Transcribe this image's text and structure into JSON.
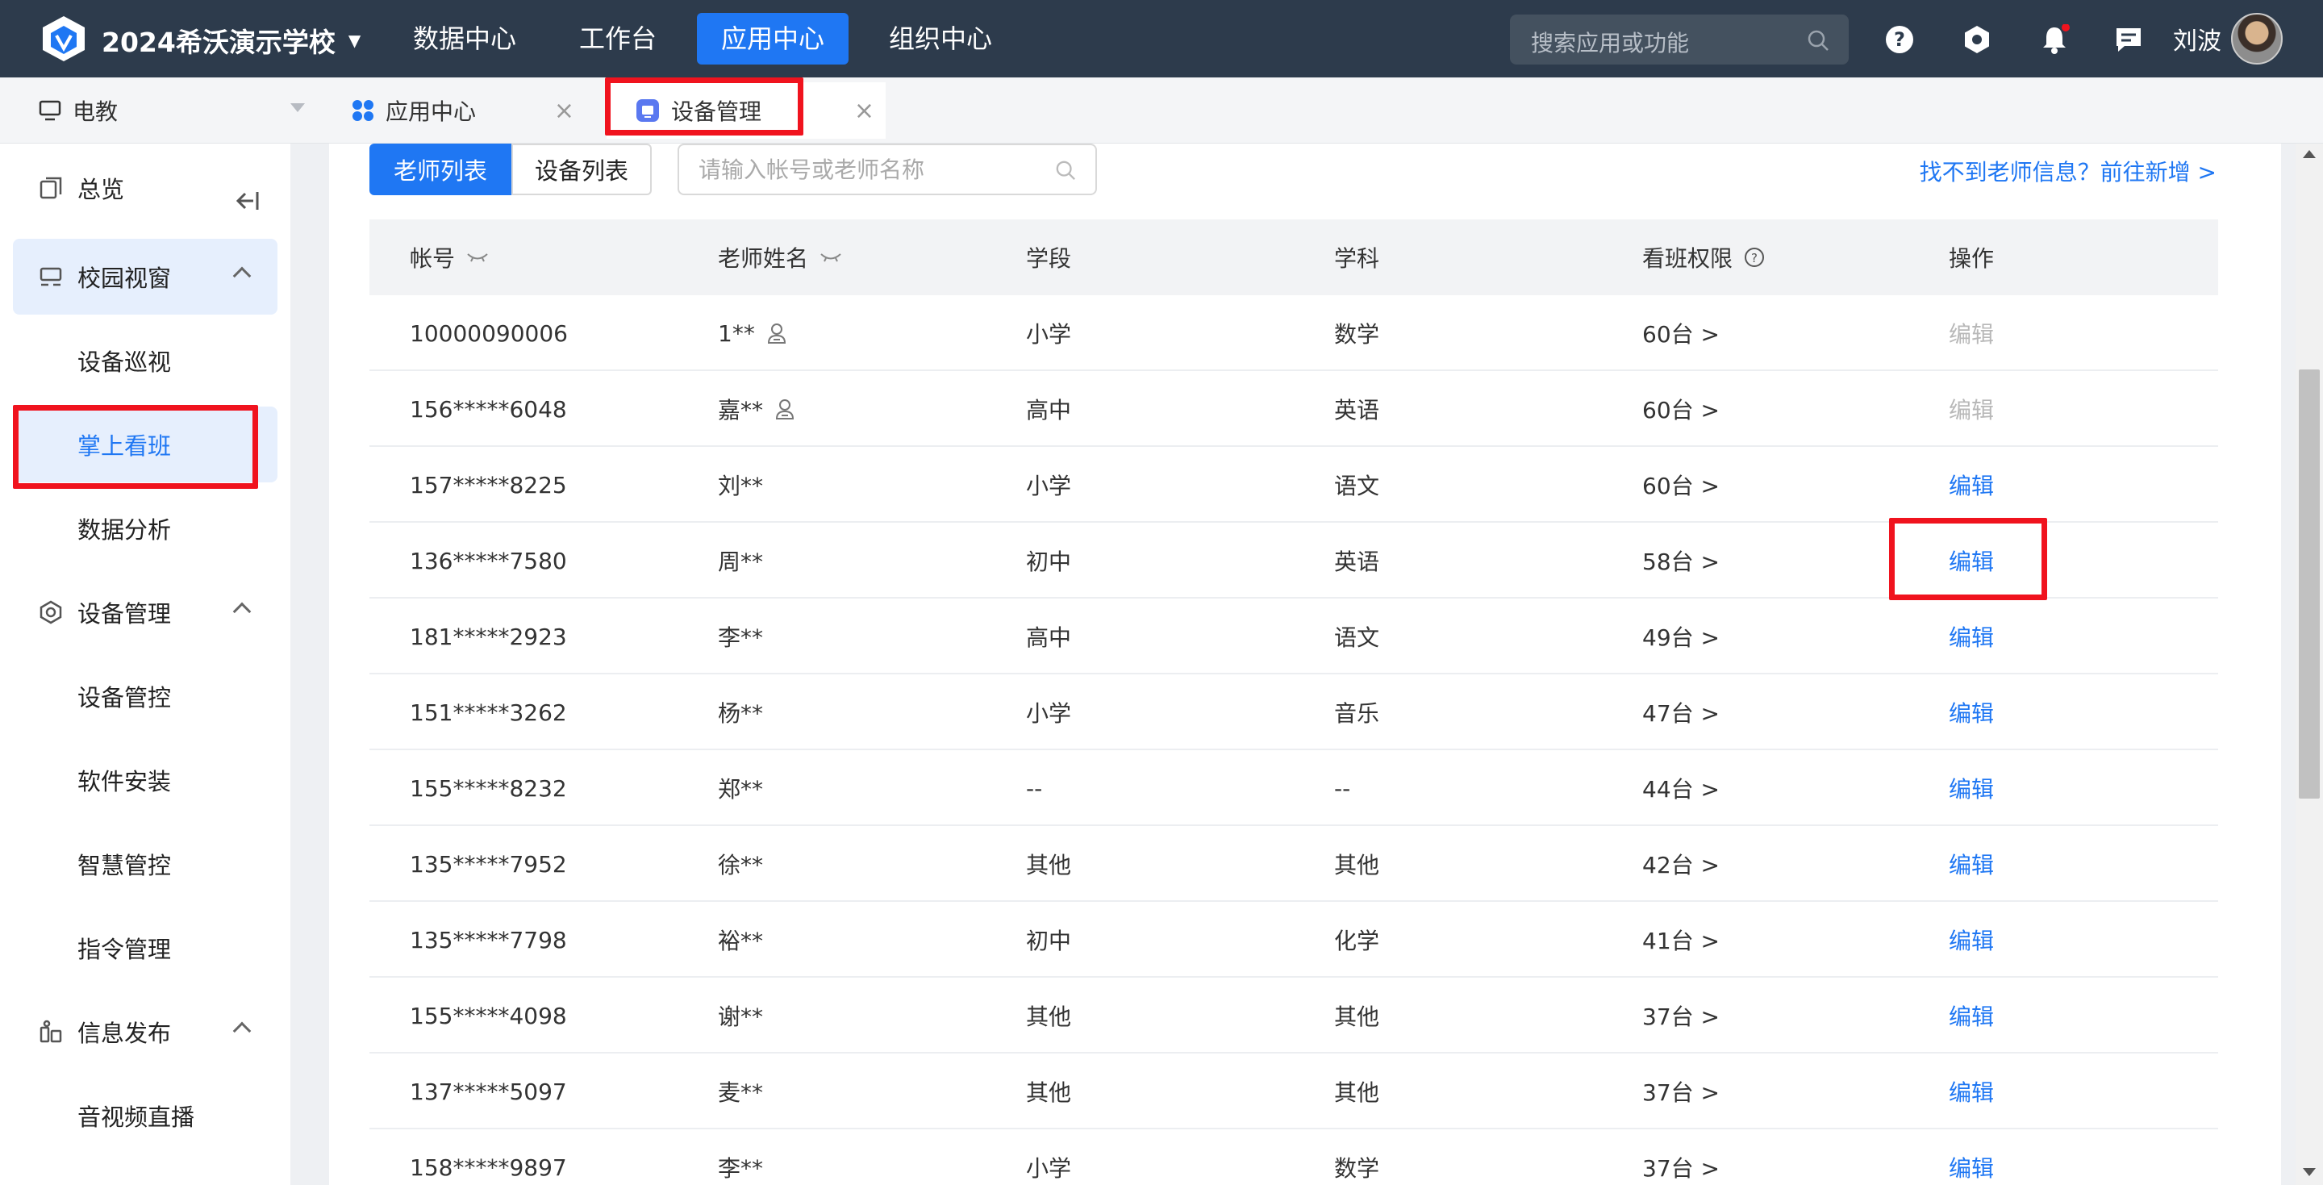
{
  "topbar": {
    "school_name": "2024希沃演示学校",
    "nav": [
      "数据中心",
      "工作台",
      "应用中心",
      "组织中心"
    ],
    "active_nav": "应用中心",
    "search_placeholder": "搜索应用或功能",
    "user_name": "刘波",
    "icons": [
      "help-icon",
      "hexagon-icon",
      "bell-icon",
      "message-icon"
    ]
  },
  "tabs": {
    "org": "电教",
    "app_center": "应用中心",
    "device_mgmt": "设备管理"
  },
  "sidebar": {
    "overview": "总览",
    "campus_window": "校园视窗",
    "device_patrol": "设备巡视",
    "handheld_class": "掌上看班",
    "data_analysis": "数据分析",
    "device_mgmt": "设备管理",
    "device_control": "设备管控",
    "software_install": "软件安装",
    "smart_control": "智慧管控",
    "command_mgmt": "指令管理",
    "info_publish": "信息发布",
    "av_live": "音视频直播"
  },
  "toolbar": {
    "teacher_list": "老师列表",
    "device_list": "设备列表",
    "search_placeholder": "请输入帐号或老师名称",
    "add_link": "找不到老师信息？前往新增 >"
  },
  "table": {
    "headers": [
      "帐号",
      "老师姓名",
      "学段",
      "学科",
      "看班权限",
      "操作"
    ],
    "rows": [
      {
        "account": "10000090006",
        "name": "1**",
        "user_icon": true,
        "stage": "小学",
        "subject": "数学",
        "perm": "60台 >",
        "action": "编辑",
        "disabled": true
      },
      {
        "account": "156*****6048",
        "name": "嘉**",
        "user_icon": true,
        "stage": "高中",
        "subject": "英语",
        "perm": "60台 >",
        "action": "编辑",
        "disabled": true
      },
      {
        "account": "157*****8225",
        "name": "刘**",
        "user_icon": false,
        "stage": "小学",
        "subject": "语文",
        "perm": "60台 >",
        "action": "编辑",
        "disabled": false
      },
      {
        "account": "136*****7580",
        "name": "周**",
        "user_icon": false,
        "stage": "初中",
        "subject": "英语",
        "perm": "58台 >",
        "action": "编辑",
        "disabled": false
      },
      {
        "account": "181*****2923",
        "name": "李**",
        "user_icon": false,
        "stage": "高中",
        "subject": "语文",
        "perm": "49台 >",
        "action": "编辑",
        "disabled": false
      },
      {
        "account": "151*****3262",
        "name": "杨**",
        "user_icon": false,
        "stage": "小学",
        "subject": "音乐",
        "perm": "47台 >",
        "action": "编辑",
        "disabled": false
      },
      {
        "account": "155*****8232",
        "name": "郑**",
        "user_icon": false,
        "stage": "--",
        "subject": "--",
        "perm": "44台 >",
        "action": "编辑",
        "disabled": false
      },
      {
        "account": "135*****7952",
        "name": "徐**",
        "user_icon": false,
        "stage": "其他",
        "subject": "其他",
        "perm": "42台 >",
        "action": "编辑",
        "disabled": false
      },
      {
        "account": "135*****7798",
        "name": "裕**",
        "user_icon": false,
        "stage": "初中",
        "subject": "化学",
        "perm": "41台 >",
        "action": "编辑",
        "disabled": false
      },
      {
        "account": "155*****4098",
        "name": "谢**",
        "user_icon": false,
        "stage": "其他",
        "subject": "其他",
        "perm": "37台 >",
        "action": "编辑",
        "disabled": false
      },
      {
        "account": "137*****5097",
        "name": "麦**",
        "user_icon": false,
        "stage": "其他",
        "subject": "其他",
        "perm": "37台 >",
        "action": "编辑",
        "disabled": false
      },
      {
        "account": "158*****9897",
        "name": "李**",
        "user_icon": false,
        "stage": "小学",
        "subject": "数学",
        "perm": "37台 >",
        "action": "编辑",
        "disabled": false
      }
    ]
  },
  "colors": {
    "primary": "#1f77f3",
    "topbar": "#2d3b4c",
    "highlight": "#f0131e"
  }
}
